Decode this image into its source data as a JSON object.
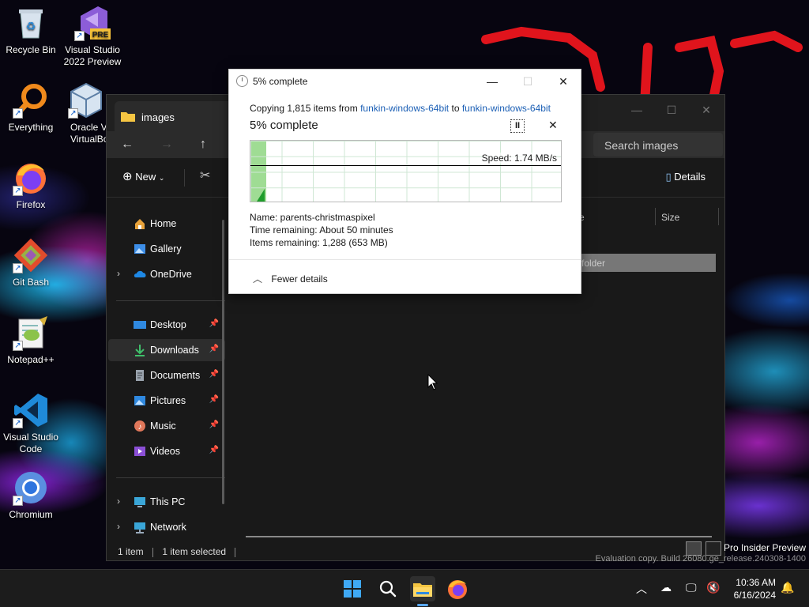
{
  "desktop": {
    "icons": [
      {
        "label": "Recycle Bin"
      },
      {
        "label": "Visual Studio 2022 Preview",
        "badge": "PRE"
      },
      {
        "label": "Everything"
      },
      {
        "label": "Oracle VM VirtualBox",
        "label_visible": "Oracle V VirtualBo"
      },
      {
        "label": "Firefox"
      },
      {
        "label": "Git Bash"
      },
      {
        "label": "Notepad++"
      },
      {
        "label": "Visual Studio Code"
      },
      {
        "label": "Chromium"
      }
    ]
  },
  "explorer": {
    "tab_title": "images",
    "search_placeholder": "Search images",
    "new_label": "New",
    "details_label": "Details",
    "column_partial": "e",
    "column_size": "Size",
    "selected_row_text": "folder",
    "nav": {
      "home": "Home",
      "gallery": "Gallery",
      "onedrive": "OneDrive",
      "desktop": "Desktop",
      "downloads": "Downloads",
      "documents": "Documents",
      "pictures": "Pictures",
      "music": "Music",
      "videos": "Videos",
      "this_pc": "This PC",
      "network": "Network"
    },
    "status": {
      "item_count": "1 item",
      "selected": "1 item selected"
    }
  },
  "progress_dialog": {
    "title": "5% complete",
    "copy_prefix": "Copying 1,815 items from",
    "source": "funkin-windows-64bit",
    "to_word": "to",
    "destination": "funkin-windows-64bit",
    "heading": "5% complete",
    "progress_fraction": 0.05,
    "speed_text": "Speed: 1.74 MB/s",
    "name_line": "Name:  parents-christmaspixel",
    "time_line": "Time remaining:  About 50 minutes",
    "items_line": "Items remaining:  1,288 (653 MB)",
    "fewer_details": "Fewer details"
  },
  "watermark": {
    "line1": "Pro Insider Preview",
    "line2": "Evaluation copy. Build 26080.ge_release.240308-1400"
  },
  "taskbar": {
    "time": "10:36 AM",
    "date": "6/16/2024"
  },
  "colors": {
    "accent": "#0078d4",
    "link": "#1b5fb5",
    "progress_green": "#9fdc94"
  }
}
